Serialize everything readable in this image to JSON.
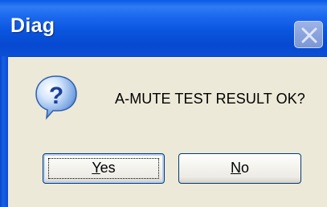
{
  "window": {
    "title": "Diag",
    "close_icon": "close-icon"
  },
  "dialog": {
    "icon": "question-icon",
    "message": "A-MUTE TEST RESULT OK?"
  },
  "buttons": {
    "yes": {
      "mnemonic": "Y",
      "rest": "es"
    },
    "no": {
      "mnemonic": "N",
      "rest": "o"
    }
  },
  "colors": {
    "titlebar": "#0a55de",
    "dialog_background": "#ece9d8",
    "button_border": "#003c74"
  }
}
